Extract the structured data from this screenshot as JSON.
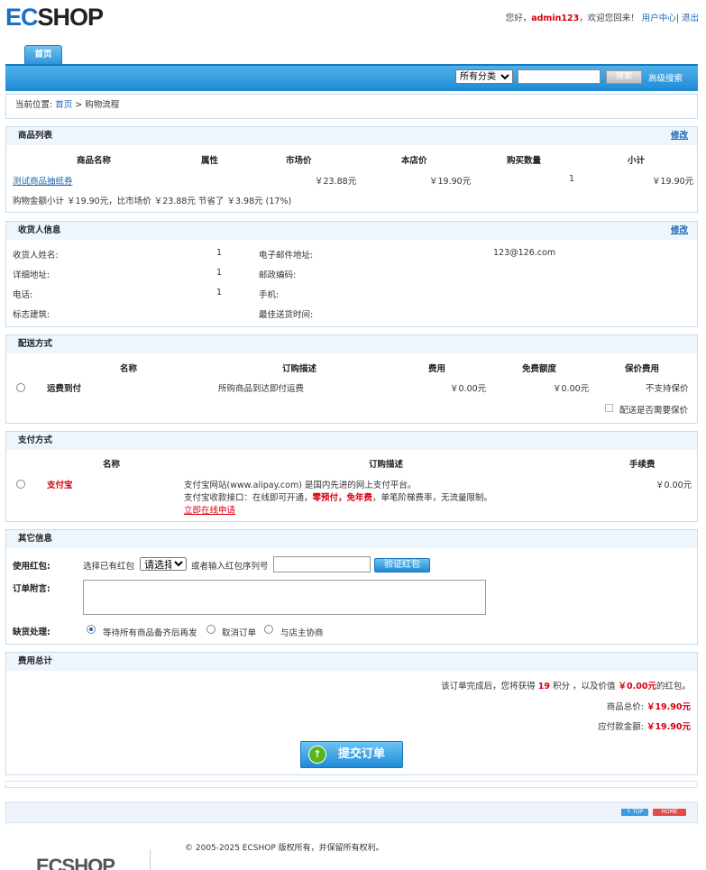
{
  "header": {
    "logo": "ECSHOP",
    "greeting": "您好，",
    "username": "admin123",
    "welcome": "，欢迎您回来！",
    "user_center": "用户中心",
    "separator": "|",
    "logout": "退出"
  },
  "nav": {
    "home_tab": "首页",
    "category_selected": "所有分类",
    "search_button": "搜索",
    "advanced_search": "高级搜索"
  },
  "breadcrumb": {
    "prefix": "当前位置:",
    "home": "首页",
    "arrow": ">",
    "current": "购物流程"
  },
  "goods": {
    "title": "商品列表",
    "edit": "修改",
    "columns": [
      "商品名称",
      "属性",
      "市场价",
      "本店价",
      "购买数量",
      "小计"
    ],
    "row": {
      "name": "测试商品抽纸券",
      "attr": "",
      "market_price": "￥23.88元",
      "shop_price": "￥19.90元",
      "qty": "1",
      "subtotal": "￥19.90元"
    },
    "summary": "购物金额小计 ￥19.90元，比市场价 ￥23.88元 节省了 ￥3.98元 (17%)"
  },
  "consignee": {
    "title": "收货人信息",
    "edit": "修改",
    "name_label": "收货人姓名:",
    "name_value": "1",
    "email_label": "电子邮件地址:",
    "email_value": "123@126.com",
    "address_label": "详细地址:",
    "address_value": "1",
    "zip_label": "邮政编码:",
    "zip_value": "",
    "tel_label": "电话:",
    "tel_value": "1",
    "mobile_label": "手机:",
    "mobile_value": "",
    "building_label": "标志建筑:",
    "building_value": "",
    "best_time_label": "最佳送货时间:",
    "best_time_value": ""
  },
  "shipping": {
    "title": "配送方式",
    "columns": [
      "名称",
      "订购描述",
      "费用",
      "免费额度",
      "保价费用"
    ],
    "row": {
      "name": "运费到付",
      "desc": "所购商品到达即付运费",
      "fee": "￥0.00元",
      "free": "￥0.00元",
      "insure": "不支持保价"
    },
    "insure_label": "配送是否需要保价"
  },
  "payment": {
    "title": "支付方式",
    "columns": [
      "名称",
      "订购描述",
      "手续费"
    ],
    "row": {
      "name": "支付宝",
      "desc1": "支付宝网站(www.alipay.com) 是国内先进的网上支付平台。",
      "desc2_a": "支付宝收款接口：在线即可开通，",
      "desc2_b": "零预付，免年费",
      "desc2_c": "，单笔阶梯费率，无流量限制。",
      "apply_link": "立即在线申请",
      "fee": "￥0.00元"
    }
  },
  "other": {
    "title": "其它信息",
    "bonus_label": "使用红包:",
    "bonus_choose": "选择已有红包",
    "bonus_select": "请选择",
    "bonus_or": "或者输入红包序列号",
    "bonus_validate": "验证红包",
    "postscript_label": "订单附言:",
    "stock_label": "缺货处理:",
    "stock_opt1": "等待所有商品备齐后再发",
    "stock_opt2": "取消订单",
    "stock_opt3": "与店主协商"
  },
  "total": {
    "title": "费用总计",
    "line1_a": "该订单完成后，您将获得",
    "points": "19",
    "line1_b": "积分 ，以及价值",
    "bonus_value": "￥0.00元",
    "line1_c": "的红包。",
    "goods_total_label": "商品总价:",
    "goods_total": "￥19.90元",
    "pay_label": "应付款金额:",
    "pay": "￥19.90元",
    "submit": "提交订单"
  },
  "footer": {
    "top_badge": "↑ TOP",
    "home_badge": "HOME",
    "copyright": "© 2005-2025 ECSHOP 版权所有，并保留所有权利。",
    "logo": "ECSHOP"
  }
}
